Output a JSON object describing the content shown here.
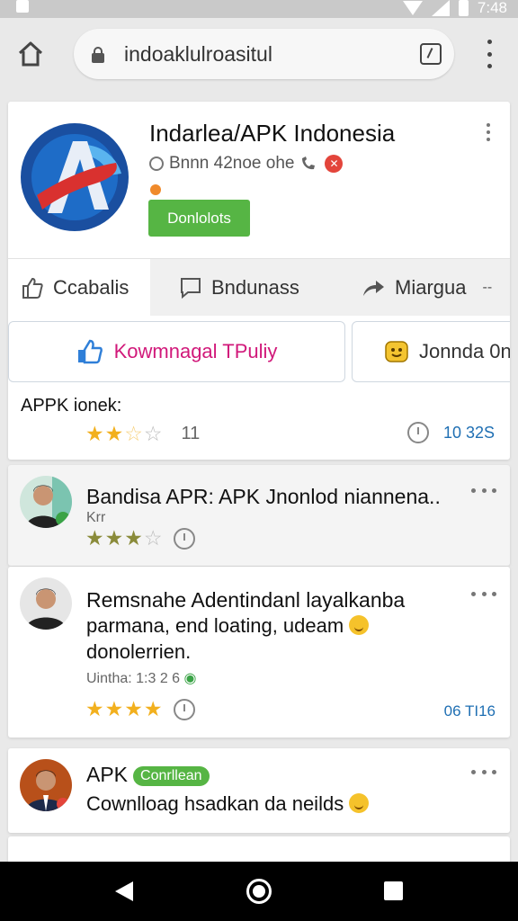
{
  "status_bar": {
    "time": "7:48"
  },
  "browser": {
    "url": "indoaklulroasitul"
  },
  "app": {
    "title": "Indarlea/APK Indonesia",
    "subtitle": "Bnnn 42noe ohe",
    "download_label": "Donlolots",
    "tabs": [
      {
        "label": "Ccabalis"
      },
      {
        "label": "Bndunass"
      },
      {
        "label": "Miargua"
      }
    ],
    "primary_action": "Kowmnagal TPuliy",
    "secondary_action": "Jonnda 0n",
    "rating_label": "APPK ionek:",
    "rating_stars": 2.5,
    "rating_count": "11",
    "size": "10 32S"
  },
  "reviews": [
    {
      "name": "Bandisa APR: APK Jnonlod niannena..",
      "meta": "Krr",
      "stars": 3,
      "text": ""
    },
    {
      "name": "Remsnahe Adentindanl layalkanba",
      "text_line1": "parmana, end loating, udeam",
      "text_line2": "donolerrien.",
      "meta": "Uintha: 1:3 2 6",
      "stars": 4,
      "date": "06 TI16"
    },
    {
      "name": "APK",
      "badge": "Conrllean",
      "text": "Cownlloag hsadkan da neilds"
    }
  ],
  "colors": {
    "accent_green": "#56b544",
    "link_blue": "#1f6fb3",
    "star": "#f2b01e",
    "magenta": "#d1197a"
  },
  "icons": [
    "home-icon",
    "lock-icon",
    "tab-switcher-icon",
    "menu-icon",
    "thumbs-up-icon",
    "chat-icon",
    "share-icon",
    "clock-icon",
    "back-icon",
    "home-nav-icon",
    "recents-icon"
  ]
}
